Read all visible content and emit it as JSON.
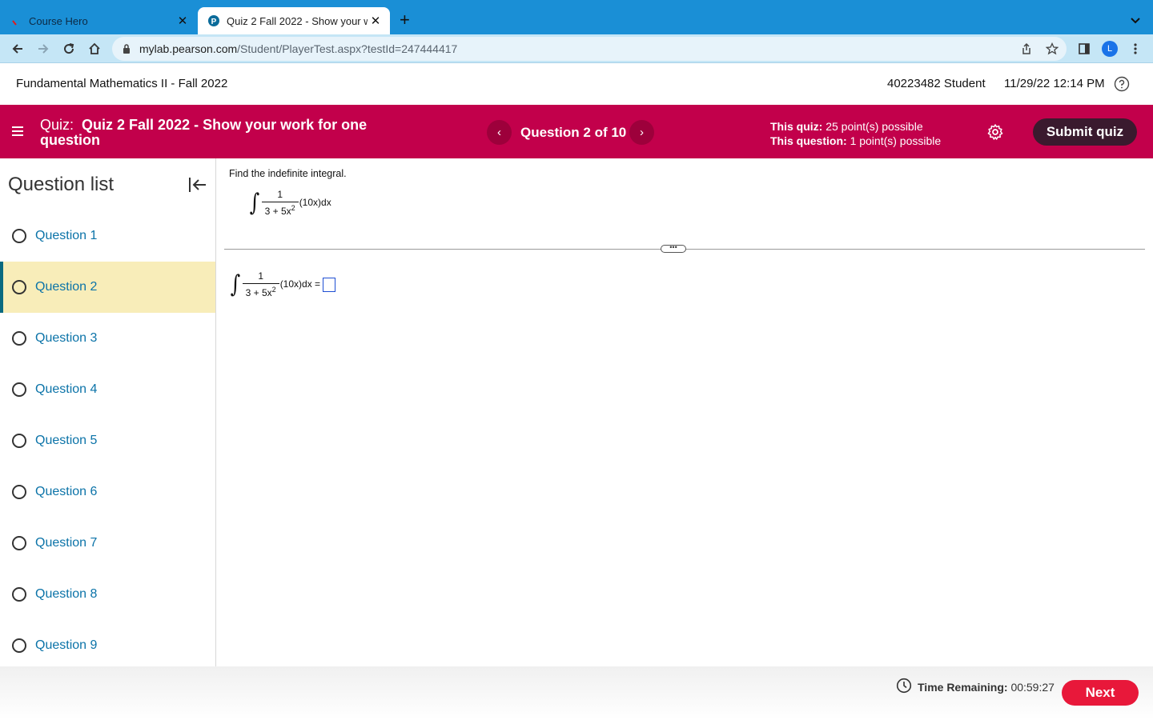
{
  "browser": {
    "tabs": [
      {
        "title": "Course Hero",
        "active": false
      },
      {
        "title": "Quiz 2 Fall 2022 - Show your w",
        "active": true
      }
    ],
    "new_tab_label": "+",
    "url_host": "mylab.pearson.com",
    "url_path": "/Student/PlayerTest.aspx?testId=247444417",
    "profile_initial": "L",
    "accent": "#1a8fd6"
  },
  "header": {
    "course_title": "Fundamental Mathematics II - Fall 2022",
    "user": "40223482 Student",
    "datetime": "11/29/22 12:14 PM"
  },
  "quizbar": {
    "label": "Quiz:",
    "title": "Quiz 2 Fall 2022 - Show your work for one question",
    "question_position": "Question 2 of 10",
    "prev_symbol": "‹",
    "next_symbol": "›",
    "quiz_points_label": "This quiz:",
    "quiz_points_value": "25 point(s) possible",
    "question_points_label": "This question:",
    "question_points_value": "1 point(s) possible",
    "submit_label": "Submit quiz",
    "color": "#c2004b"
  },
  "sidebar": {
    "title": "Question list",
    "items": [
      {
        "label": "Question 1",
        "current": false
      },
      {
        "label": "Question 2",
        "current": true
      },
      {
        "label": "Question 3",
        "current": false
      },
      {
        "label": "Question 4",
        "current": false
      },
      {
        "label": "Question 5",
        "current": false
      },
      {
        "label": "Question 6",
        "current": false
      },
      {
        "label": "Question 7",
        "current": false
      },
      {
        "label": "Question 8",
        "current": false
      },
      {
        "label": "Question 9",
        "current": false
      }
    ]
  },
  "question": {
    "prompt": "Find the indefinite integral.",
    "integral_sign": "∫",
    "numerator": "1",
    "denominator_base": "3 + 5x",
    "denominator_exp": "2",
    "integrand_tail": "(10x)dx",
    "answer_tail": "(10x)dx =",
    "handle_symbol": "•••"
  },
  "footer": {
    "time_label": "Time Remaining:",
    "time_value": "00:59:27",
    "next_label": "Next"
  }
}
